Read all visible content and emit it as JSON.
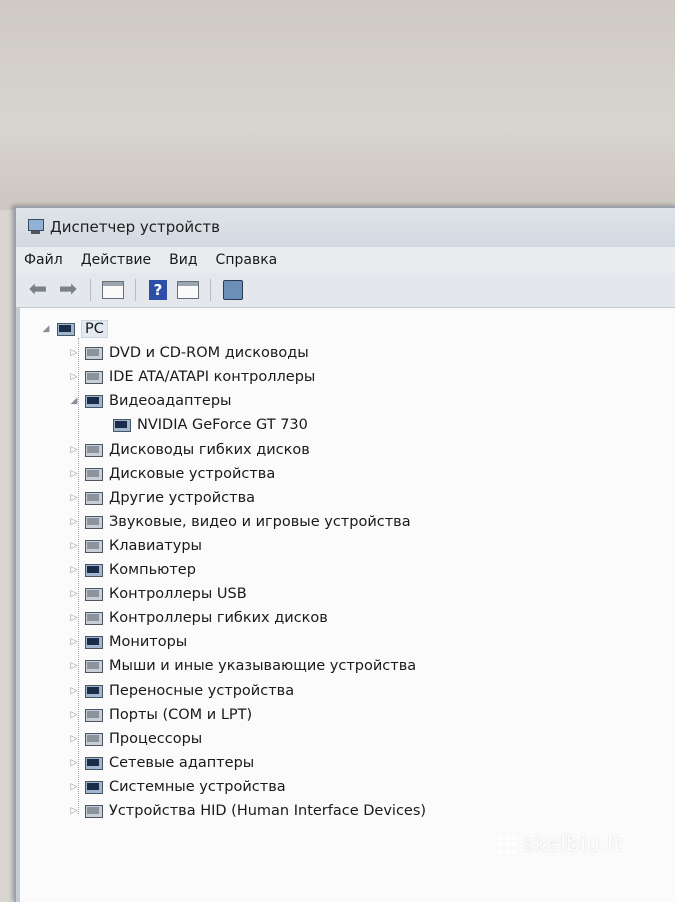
{
  "window": {
    "title": "Диспетчер устройств",
    "title_icon": "device-manager-icon"
  },
  "menu": [
    "Файл",
    "Действие",
    "Вид",
    "Справка"
  ],
  "toolbar": {
    "buttons": [
      "back-arrow-icon",
      "forward-arrow-icon",
      "properties-icon",
      "help-icon",
      "action-pane-icon",
      "scan-hardware-icon"
    ]
  },
  "tree": {
    "root": {
      "label": "PC",
      "expanded": true
    },
    "categories": [
      {
        "label": "DVD и CD-ROM дисководы",
        "expanded": false,
        "icon": "dvd-drive-icon"
      },
      {
        "label": "IDE ATA/ATAPI контроллеры",
        "expanded": false,
        "icon": "ide-controller-icon"
      },
      {
        "label": "Видеоадаптеры",
        "expanded": true,
        "icon": "display-adapter-icon",
        "children": [
          {
            "label": "NVIDIA GeForce GT 730",
            "icon": "display-adapter-icon"
          }
        ]
      },
      {
        "label": "Дисководы гибких дисков",
        "expanded": false,
        "icon": "floppy-drive-icon"
      },
      {
        "label": "Дисковые устройства",
        "expanded": false,
        "icon": "disk-drive-icon"
      },
      {
        "label": "Другие устройства",
        "expanded": false,
        "icon": "other-devices-icon"
      },
      {
        "label": "Звуковые, видео и игровые устройства",
        "expanded": false,
        "icon": "sound-icon"
      },
      {
        "label": "Клавиатуры",
        "expanded": false,
        "icon": "keyboard-icon"
      },
      {
        "label": "Компьютер",
        "expanded": false,
        "icon": "computer-icon"
      },
      {
        "label": "Контроллеры USB",
        "expanded": false,
        "icon": "usb-icon"
      },
      {
        "label": "Контроллеры гибких дисков",
        "expanded": false,
        "icon": "floppy-controller-icon"
      },
      {
        "label": "Мониторы",
        "expanded": false,
        "icon": "monitor-icon"
      },
      {
        "label": "Мыши и иные указывающие устройства",
        "expanded": false,
        "icon": "mouse-icon"
      },
      {
        "label": "Переносные устройства",
        "expanded": false,
        "icon": "portable-device-icon"
      },
      {
        "label": "Порты (COM и LPT)",
        "expanded": false,
        "icon": "port-icon"
      },
      {
        "label": "Процессоры",
        "expanded": false,
        "icon": "processor-icon"
      },
      {
        "label": "Сетевые адаптеры",
        "expanded": false,
        "icon": "network-adapter-icon"
      },
      {
        "label": "Системные устройства",
        "expanded": false,
        "icon": "system-devices-icon"
      },
      {
        "label": "Устройства HID (Human Interface Devices)",
        "expanded": false,
        "icon": "hid-icon"
      }
    ]
  },
  "watermark": "skelbiu.lt"
}
